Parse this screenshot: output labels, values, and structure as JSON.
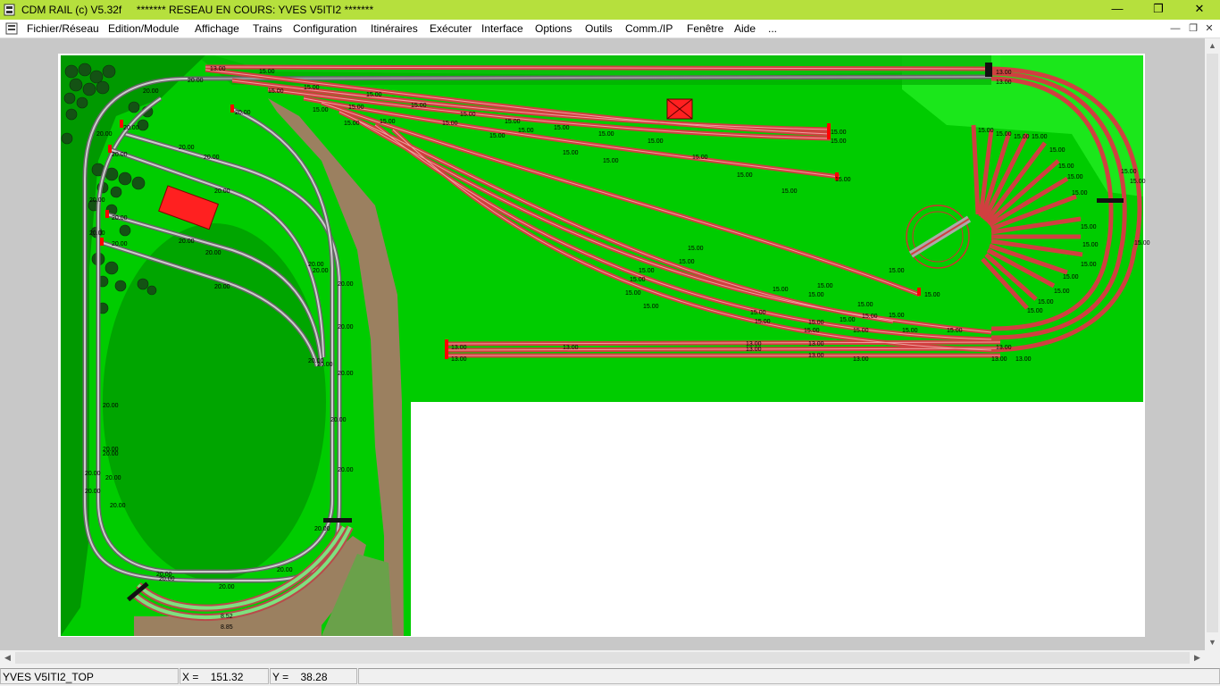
{
  "window": {
    "app_name": "CDM RAIL (c) V5.32f",
    "status_title": "******* RESEAU EN COURS: YVES V5ITI2 *******",
    "controls": {
      "minimize": "—",
      "restore": "❐",
      "close": "✕"
    }
  },
  "menu": {
    "items": [
      "Fichier/Réseau",
      "Edition/Module",
      "Affichage",
      "Trains",
      "Configuration",
      "Itinéraires",
      "Exécuter",
      "Interface",
      "Options",
      "Outils",
      "Comm./IP",
      "Fenêtre",
      "Aide",
      "..."
    ],
    "mdi_controls": {
      "minimize": "—",
      "restore": "❐",
      "close": "✕"
    }
  },
  "colors": {
    "title_bar": "#b6e03d",
    "layout_grass": "#00cc00",
    "dark_grass": "#009900",
    "light_grass": "#22ee22",
    "track_red": "#e03030",
    "track_grey": "#999999",
    "road_brown": "#9b8060",
    "building_red": "#ff2020"
  },
  "layout": {
    "labels": {
      "t15": "15.00",
      "t20": "20.00",
      "t13": "13.00",
      "t852": "8.52",
      "t885": "8.85"
    }
  },
  "status": {
    "network_name": "YVES V5ITI2_TOP",
    "x_label": "X =",
    "x_value": "151.32",
    "y_label": "Y =",
    "y_value": "38.28"
  }
}
